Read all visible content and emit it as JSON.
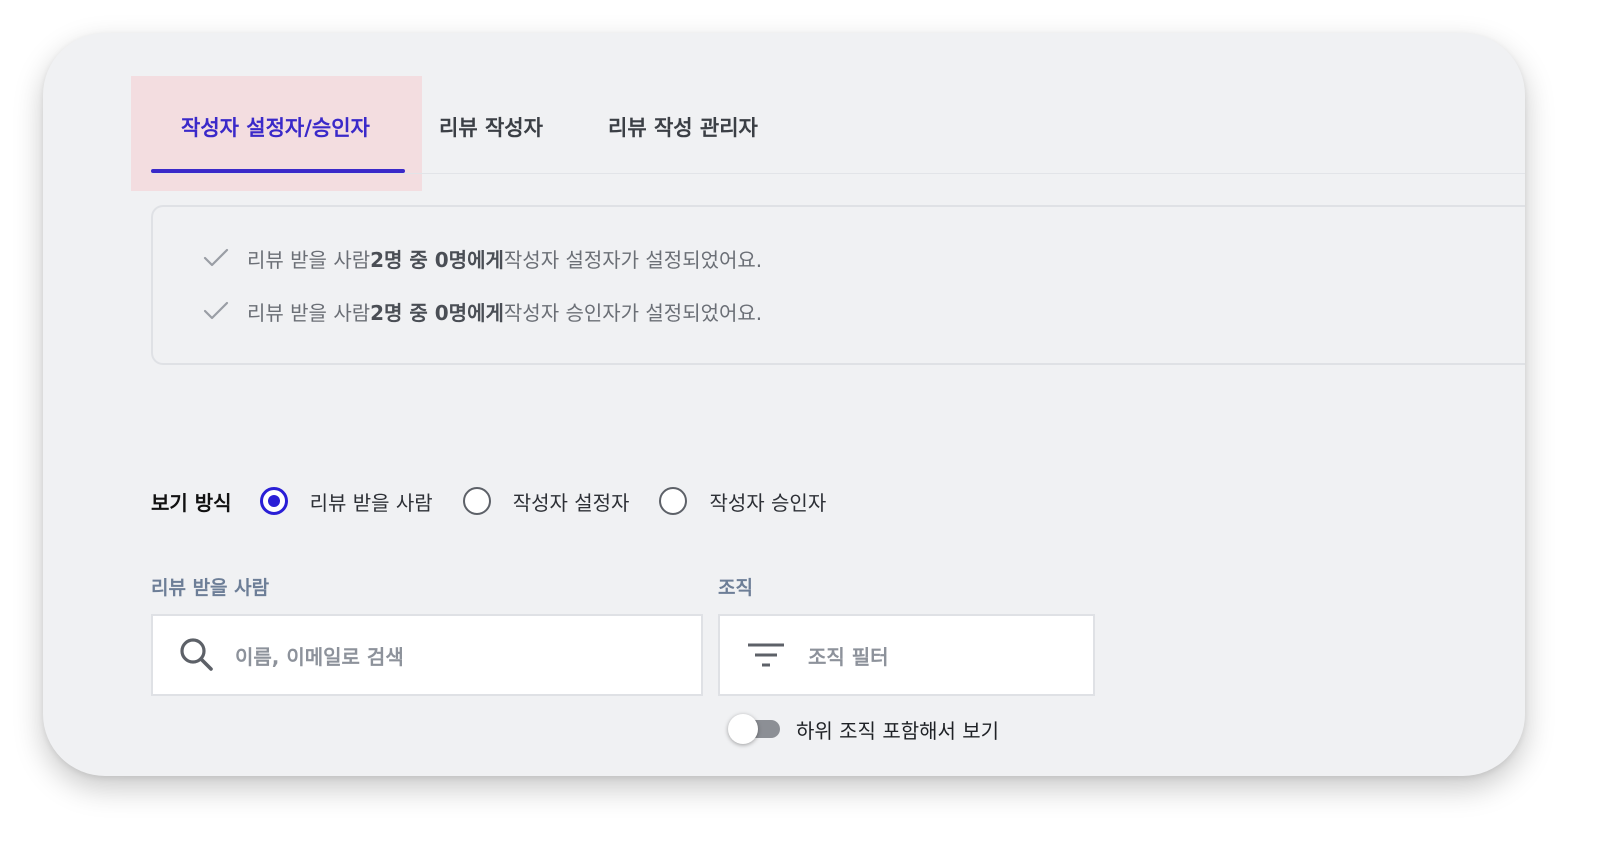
{
  "tabs": [
    {
      "label": "작성자 설정자/승인자",
      "active": true
    },
    {
      "label": "리뷰 작성자",
      "active": false
    },
    {
      "label": "리뷰 작성 관리자",
      "active": false
    }
  ],
  "notice": {
    "items": [
      {
        "prefix": "리뷰 받을 사람 ",
        "bold": "2명 중 0명에게",
        "suffix": " 작성자 설정자가 설정되었어요."
      },
      {
        "prefix": "리뷰 받을 사람 ",
        "bold": "2명 중 0명에게",
        "suffix": " 작성자 승인자가 설정되었어요."
      }
    ]
  },
  "view_mode": {
    "label": "보기 방식",
    "options": [
      {
        "label": "리뷰 받을 사람",
        "checked": true
      },
      {
        "label": "작성자 설정자",
        "checked": false
      },
      {
        "label": "작성자 승인자",
        "checked": false
      }
    ]
  },
  "reviewee_filter": {
    "label": "리뷰 받을 사람",
    "placeholder": "이름, 이메일로 검색",
    "icon": "search-icon"
  },
  "org_filter": {
    "label": "조직",
    "placeholder": "조직 필터",
    "icon": "filter-icon"
  },
  "sub_org_toggle": {
    "label": "하위 조직 포함해서 보기",
    "on": false
  },
  "colors": {
    "accent": "#3a29c9",
    "radio": "#2a1fd6",
    "tab_highlight": "#f3dde0",
    "field_label": "#6d7e97"
  }
}
